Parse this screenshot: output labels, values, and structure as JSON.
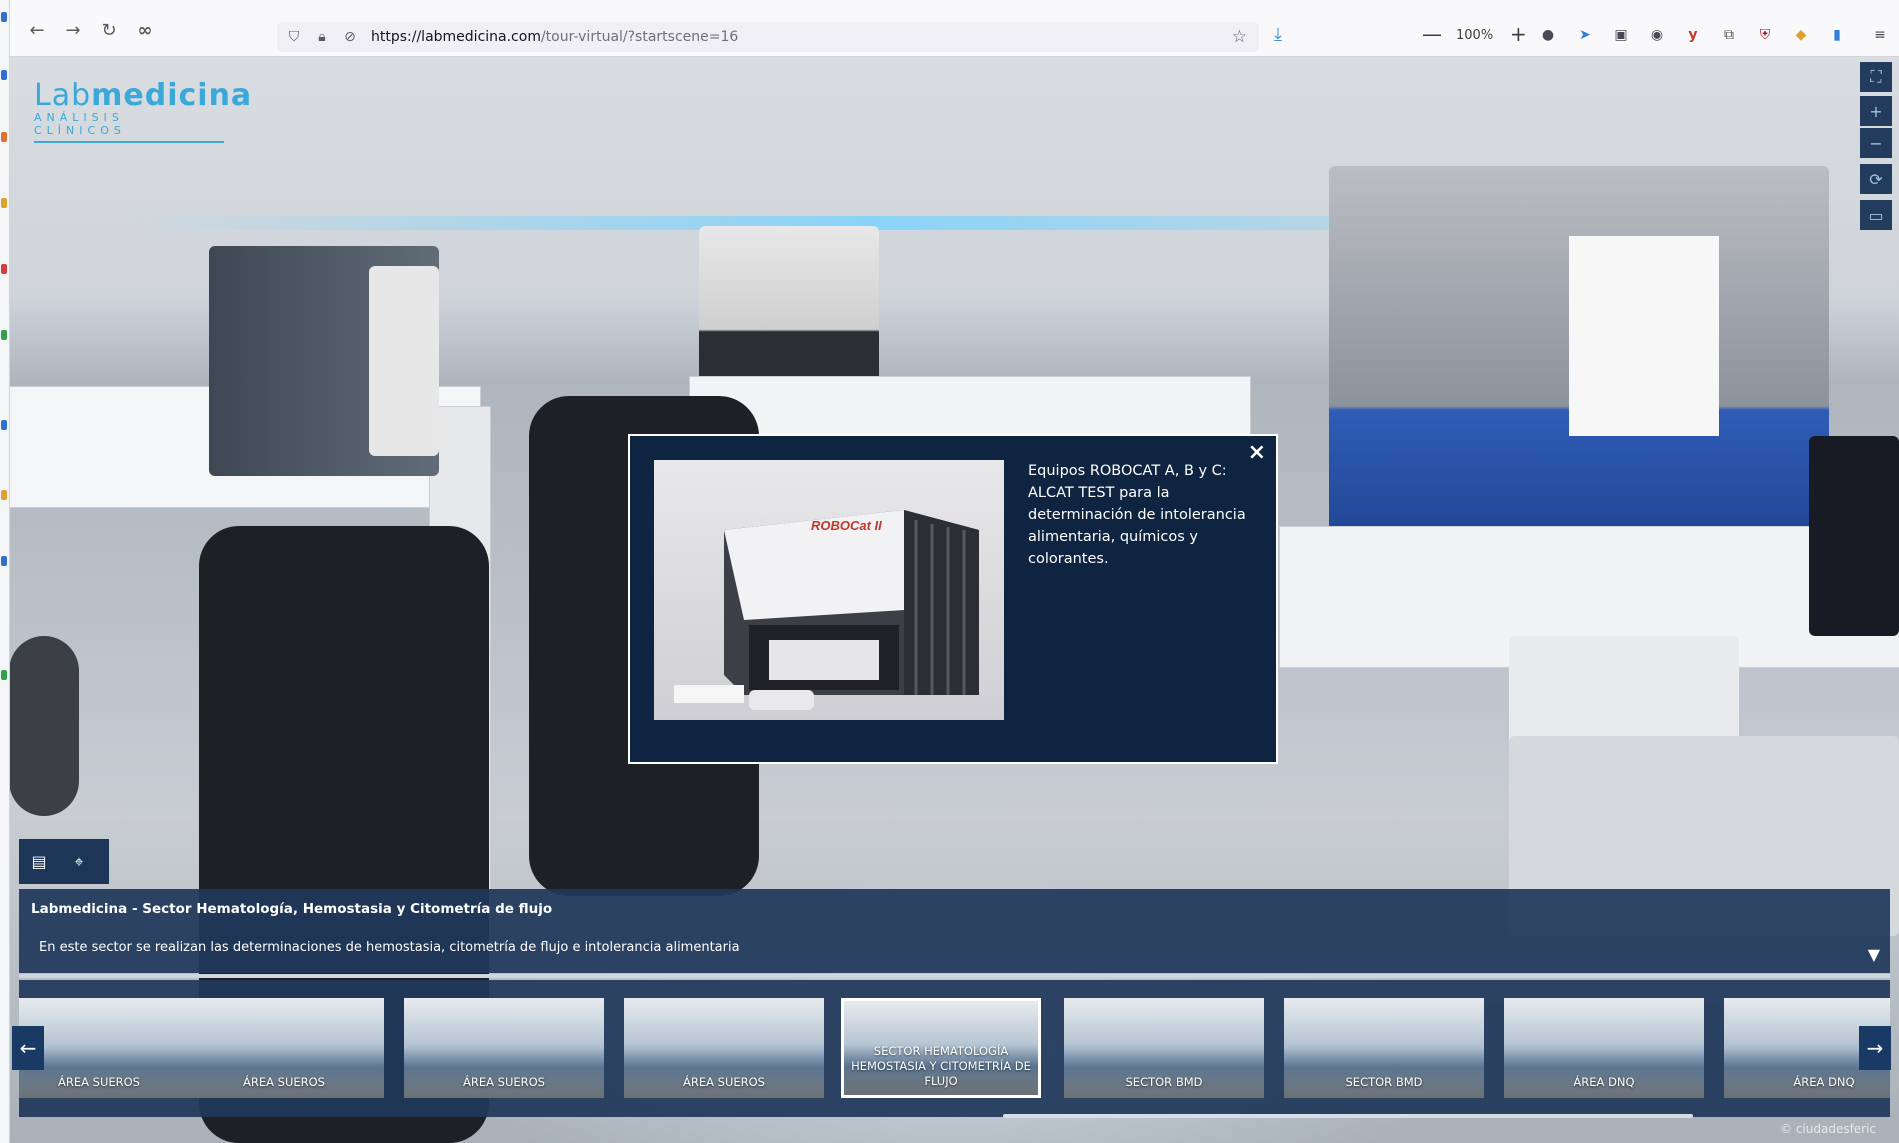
{
  "browser": {
    "url_host": "https://labmedicina.com",
    "url_path": "/tour-virtual/?startscene=16",
    "zoom": "100%",
    "zoom_minus": "—",
    "zoom_plus": "+"
  },
  "logo": {
    "main_a": "Lab",
    "main_b": "medicina",
    "sub": "ANÁLISIS CLÍNICOS"
  },
  "modal": {
    "close": "×",
    "text": "Equipos ROBOCAT A, B y C: ALCAT TEST para la determinación de intolerancia alimentaria, químicos y colorantes.",
    "image_brand": "ROBOCat II"
  },
  "scene": {
    "title": "Labmedicina - Sector Hematología, Hemostasia y Citometría de flujo",
    "description": "En este sector se realizan las determinaciones de hemostasia, citometría de flujo e intolerancia alimentaria"
  },
  "thumbnails": [
    {
      "label": "ÁREA SUEROS",
      "active": false
    },
    {
      "label": "ÁREA SUEROS",
      "active": false
    },
    {
      "label": "ÁREA SUEROS",
      "active": false
    },
    {
      "label": "ÁREA SUEROS",
      "active": false
    },
    {
      "label": "SECTOR HEMATOLOGÍA HEMOSTASIA Y CITOMETRÍA DE FLUJO",
      "active": true
    },
    {
      "label": "SECTOR BMD",
      "active": false
    },
    {
      "label": "SECTOR BMD",
      "active": false
    },
    {
      "label": "ÁREA DNQ",
      "active": false
    },
    {
      "label": "ÁREA DNQ",
      "active": false
    }
  ],
  "watermark": "© ciudadesferic",
  "colors": {
    "panel": "#20385a",
    "modal": "#0e2440",
    "accent": "#3aa8d8"
  },
  "icons": {
    "gallery": "gallery-icon",
    "map": "map-icon",
    "fullscreen": "fullscreen-icon",
    "zoom_in": "zoom-in-icon",
    "zoom_out": "zoom-out-icon",
    "rotate": "rotate-icon",
    "vr": "vr-icon"
  }
}
